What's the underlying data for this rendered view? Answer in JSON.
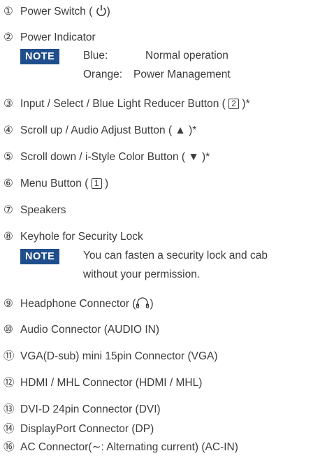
{
  "items": [
    {
      "num": "①",
      "text": "Power Switch ( ",
      "suffix": ")"
    },
    {
      "num": "②",
      "text": "Power Indicator"
    },
    {
      "num": "③",
      "text": "Input / Select / Blue Light Reducer Button ( ",
      "box": "2",
      "suffix": " )*"
    },
    {
      "num": "④",
      "text": "Scroll up / Audio Adjust Button ( ▲ )*"
    },
    {
      "num": "⑤",
      "text": "Scroll down / i-Style Color Button ( ▼ )*"
    },
    {
      "num": "⑥",
      "text": "Menu Button ( ",
      "box": "1",
      "suffix": " )"
    },
    {
      "num": "⑦",
      "text": "Speakers"
    },
    {
      "num": "⑧",
      "text": "Keyhole for Security Lock"
    },
    {
      "num": "⑨",
      "text": "Headphone Connector (",
      "suffix": ")"
    },
    {
      "num": "⑩",
      "text": "Audio Connector (AUDIO IN)"
    },
    {
      "num": "⑪",
      "text": "VGA(D-sub) mini 15pin Connector (VGA)"
    },
    {
      "num": "⑫",
      "text": "HDMI / MHL Connector (HDMI / MHL)"
    },
    {
      "num": "⑬",
      "text": "DVI-D 24pin Connector (DVI)"
    },
    {
      "num": "⑭",
      "text": "DisplayPort Connector (DP)"
    },
    {
      "num": "⑯",
      "text": "AC Connector(∼: Alternating current) (AC-IN)"
    }
  ],
  "note1": {
    "badge": "NOTE",
    "rows": [
      {
        "label": "Blue:",
        "value": "Normal operation"
      },
      {
        "label": "Orange:",
        "value": "Power Management"
      }
    ]
  },
  "note2": {
    "badge": "NOTE",
    "line1": "You can fasten a security lock and cab",
    "line2": "without your permission."
  },
  "colors": {
    "badge": "#1f4e8c",
    "text": "#3c3c3c"
  }
}
